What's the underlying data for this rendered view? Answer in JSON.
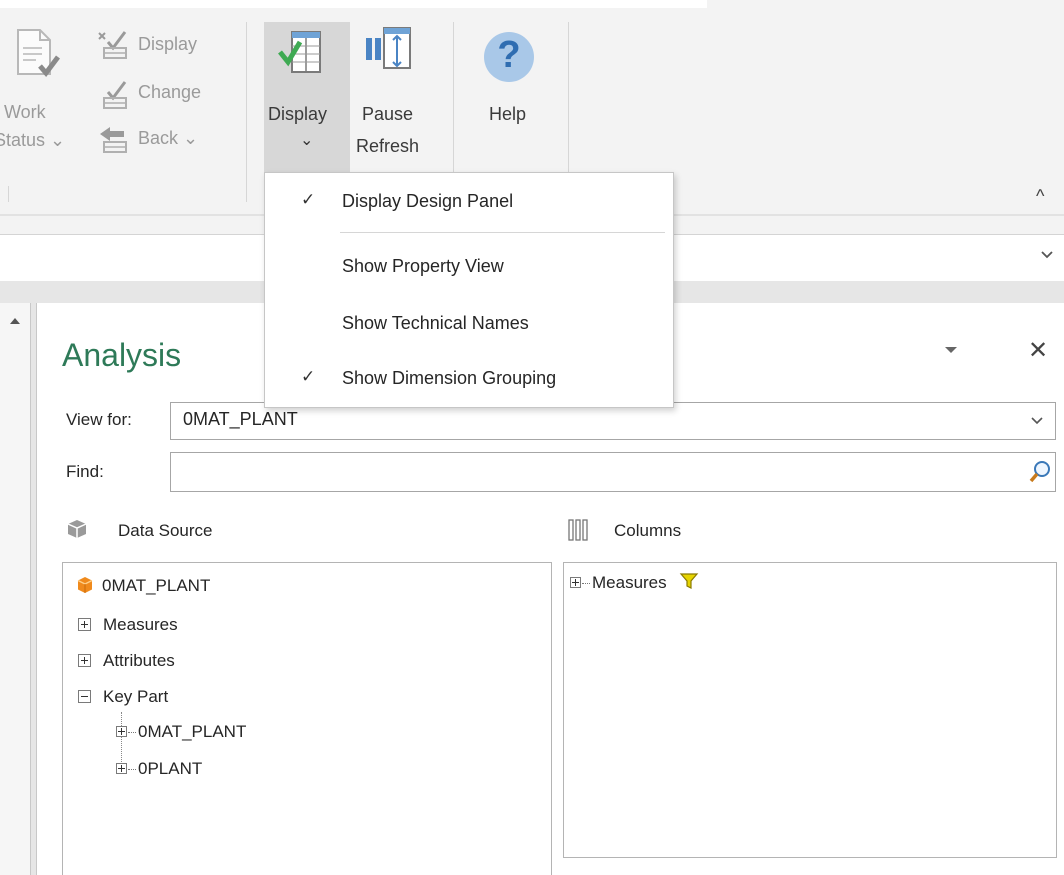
{
  "ribbon": {
    "work_status_line1": "Work",
    "work_status_line2": "Status ⌄",
    "small_btns": {
      "display": "Display",
      "change": "Change",
      "back": "Back ⌄"
    },
    "display_btn": {
      "label": "Display",
      "chevron": "⌄"
    },
    "pause_refresh": {
      "line1": "Pause",
      "line2": "Refresh"
    },
    "help": {
      "label": "Help",
      "glyph": "?"
    },
    "collapse_glyph": "^"
  },
  "menu": {
    "items": [
      {
        "label": "Display Design Panel",
        "checked": true,
        "check": "✓"
      },
      {
        "label": "Show Property View",
        "checked": false,
        "check": ""
      },
      {
        "label": "Show Technical Names",
        "checked": false,
        "check": ""
      },
      {
        "label": "Show Dimension Grouping",
        "checked": true,
        "check": "✓"
      }
    ]
  },
  "panel": {
    "title": "Analysis",
    "menu_glyph": "▼",
    "close_glyph": "✕",
    "view_for_label": "View for:",
    "view_for_value": "0MAT_PLANT",
    "find_label": "Find:",
    "find_value": "",
    "data_source_label": "Data Source",
    "columns_label": "Columns",
    "tree": {
      "root": "0MAT_PLANT",
      "measures": "Measures",
      "attributes": "Attributes",
      "key_part": "Key Part",
      "key_children": [
        "0MAT_PLANT",
        "0PLANT"
      ]
    },
    "columns": {
      "measures": "Measures"
    }
  },
  "colors": {
    "accent_green": "#2e7a58",
    "help_blue": "#3b82c4",
    "filter_yellow": "#e6d400",
    "cube_orange": "#f08a1c"
  }
}
